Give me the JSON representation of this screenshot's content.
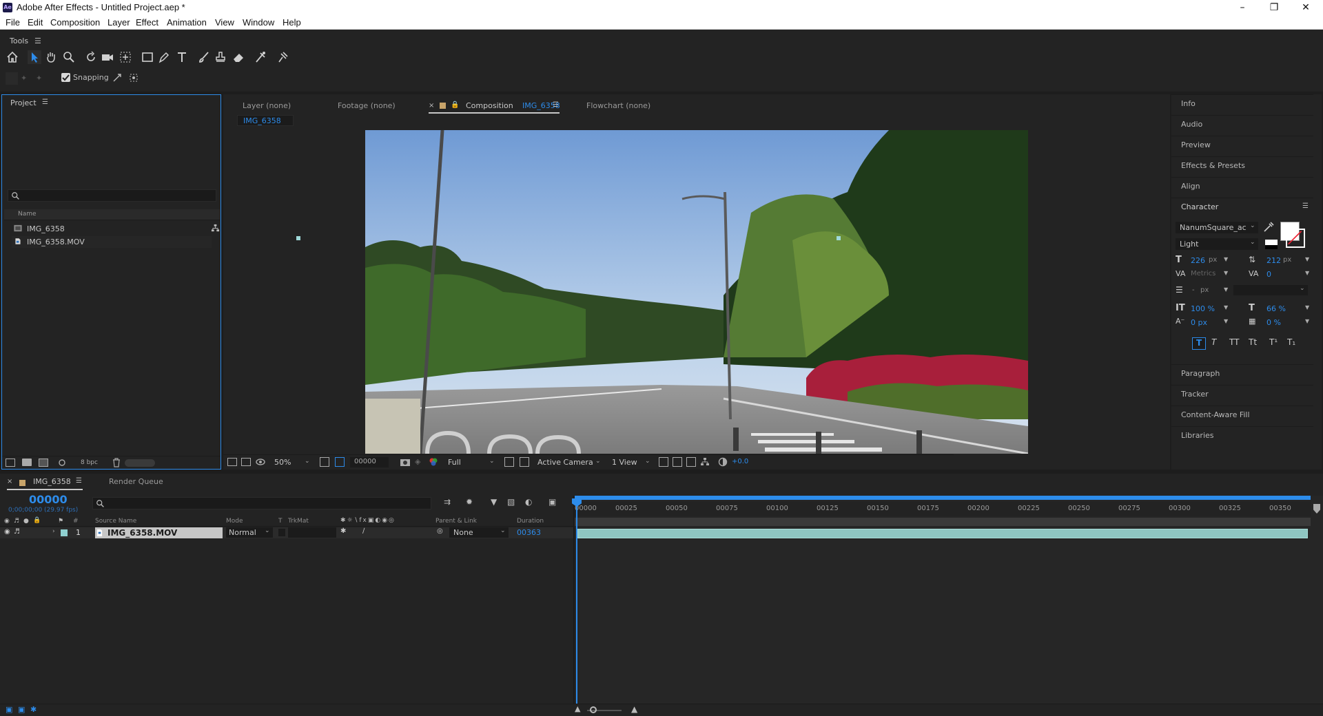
{
  "window": {
    "title": "Adobe After Effects - Untitled Project.aep *",
    "app_icon": "Ae",
    "controls": [
      "minimize",
      "restore",
      "close"
    ]
  },
  "menu": [
    "File",
    "Edit",
    "Composition",
    "Layer",
    "Effect",
    "Animation",
    "View",
    "Window",
    "Help"
  ],
  "tools_panel": {
    "label": "Tools",
    "snapping_label": "Snapping",
    "snapping_checked": true
  },
  "project_panel": {
    "title": "Project",
    "search_placeholder": "",
    "column_name": "Name",
    "items": [
      {
        "name": "IMG_6358",
        "type": "composition"
      },
      {
        "name": "IMG_6358.MOV",
        "type": "footage"
      }
    ],
    "bpc": "8 bpc"
  },
  "viewer": {
    "tabs": [
      {
        "label": "Layer (none)"
      },
      {
        "label": "Footage (none)"
      },
      {
        "label_prefix": "Composition",
        "label_name": "IMG_6358",
        "active": true
      },
      {
        "label": "Flowchart (none)"
      }
    ],
    "breadcrumb": "IMG_6358",
    "footer": {
      "zoom": "50%",
      "timecode": "00000",
      "resolution": "Full",
      "camera": "Active Camera",
      "views": "1 View",
      "exposure": "+0.0"
    }
  },
  "right_panels": {
    "items_top": [
      "Info",
      "Audio",
      "Preview",
      "Effects & Presets",
      "Align"
    ],
    "character": {
      "title": "Character",
      "font_family": "NanumSquare_ac",
      "font_style": "Light",
      "font_size": "226",
      "font_size_unit": "px",
      "leading": "212",
      "leading_unit": "px",
      "kerning": "Metrics",
      "tracking": "0",
      "stroke_width_unit": "px",
      "stroke_width": "-",
      "vertical_scale": "100 %",
      "horizontal_scale": "66 %",
      "baseline_shift": "0 px",
      "tsume": "0 %",
      "fill_color": "#ffffff",
      "style_buttons": [
        "T",
        "T",
        "TT",
        "Tt",
        "T¹",
        "T₁"
      ]
    },
    "items_bottom": [
      "Paragraph",
      "Tracker",
      "Content-Aware Fill",
      "Libraries"
    ]
  },
  "timeline": {
    "tabs": [
      {
        "label": "IMG_6358",
        "active": true
      },
      {
        "label": "Render Queue"
      }
    ],
    "current_time": "00000",
    "current_time_sub": "0;00;00;00 (29.97 fps)",
    "columns": [
      "#",
      "Source Name",
      "Mode",
      "T",
      "TrkMat",
      "Parent & Link",
      "Duration"
    ],
    "layers": [
      {
        "index": "1",
        "name": "IMG_6358.MOV",
        "mode": "Normal",
        "parent": "None",
        "duration": "00363",
        "label_color": "#8fd0d0"
      }
    ],
    "ruler": [
      "00000",
      "00025",
      "00050",
      "00075",
      "00100",
      "00125",
      "00150",
      "00175",
      "00200",
      "00225",
      "00250",
      "00275",
      "00300",
      "00325",
      "00350"
    ]
  }
}
